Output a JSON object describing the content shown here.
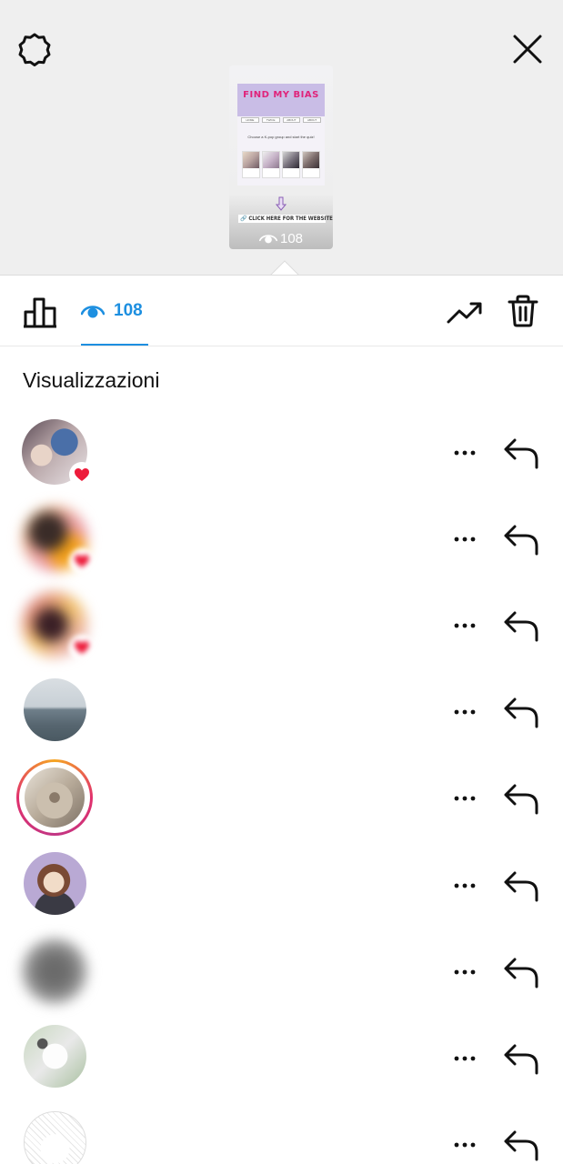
{
  "story_preview": {
    "title": "FIND MY BIAS",
    "tabs": [
      "HOME",
      "TWICE",
      "ABOUT",
      "ABOUT"
    ],
    "subtitle": "Choose a K-pop group and start the quiz!",
    "cta": "🔗 CLICK HERE FOR THE WEBSITE",
    "view_count": "108"
  },
  "icons": {
    "settings": "settings-gear-icon",
    "close": "close-icon",
    "insights": "bar-chart-icon",
    "views": "eye-icon",
    "promote": "trending-up-icon",
    "delete": "trash-icon",
    "more": "more-horizontal-icon",
    "reply": "reply-arrow-icon",
    "like": "heart-icon"
  },
  "tabbar": {
    "views_count": "108"
  },
  "section": {
    "heading": "Visualizzazioni"
  },
  "colors": {
    "accent": "#1d8fe0",
    "like": "#ed1c3b",
    "story_ring_start": "#f5a623",
    "story_ring_end": "#c13584"
  },
  "viewers": [
    {
      "avatar": "photo-two-people",
      "liked": true,
      "blurred": false,
      "story_ring": false
    },
    {
      "avatar": "blurred-photo",
      "liked": true,
      "blurred": true,
      "story_ring": false
    },
    {
      "avatar": "blurred-photo",
      "liked": true,
      "blurred": true,
      "story_ring": false
    },
    {
      "avatar": "sea-horizon-photo",
      "liked": false,
      "blurred": false,
      "story_ring": false
    },
    {
      "avatar": "plush-toy-photo",
      "liked": false,
      "blurred": false,
      "story_ring": true
    },
    {
      "avatar": "cartoon-girl-drawing",
      "liked": false,
      "blurred": false,
      "story_ring": false
    },
    {
      "avatar": "blurred-photo",
      "liked": false,
      "blurred": true,
      "story_ring": false
    },
    {
      "avatar": "cartoon-cat-drawing",
      "liked": false,
      "blurred": false,
      "story_ring": false
    },
    {
      "avatar": "sketch-drawing",
      "liked": false,
      "blurred": false,
      "story_ring": false
    }
  ]
}
